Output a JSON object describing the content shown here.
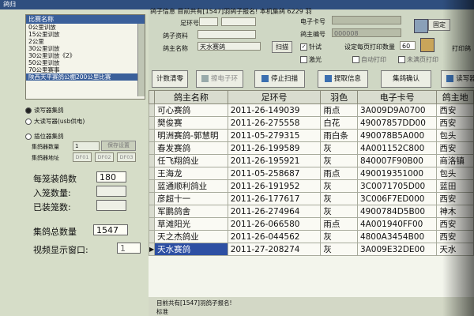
{
  "window": {
    "title": "鸽归"
  },
  "left": {
    "list_header": "比赛名称",
    "list_items": [
      "0公里训放",
      "15公里训放",
      "2公里",
      "30公里训放",
      "30公里训放《2》",
      "50公里训放",
      "70公里赛事",
      "陕西天平赛鸽公棚200公里比赛"
    ],
    "selected_index": 7,
    "radio1": "读写器集鸽",
    "radio2": "大读写器(usb供电)",
    "radio3": "插位器集鸽",
    "set_count_label": "集鸽器数量",
    "set_count_value": "1",
    "save_btn": "保存设置",
    "addr_label": "集鸽器地址",
    "addr1": "DF01",
    "addr2": "DF02",
    "addr3": "DF03",
    "per_cage_label": "每笼装鸽数",
    "per_cage_value": "180",
    "in_cage_label": "入笼数量:",
    "loaded_label": "已装笼数:",
    "total_label": "集鸽总数量",
    "total_value": "1547",
    "video_label": "视频显示窗口:",
    "video_value": "1"
  },
  "top": {
    "info": "鸽子信息  目前共有[1547]羽鸽子报名!  本机集鸽 6229 羽",
    "ring_label": "足环号",
    "pigeon_info_label": "鸽子资料",
    "owner_label": "鸽主名称",
    "owner_value": "天水赛鸽",
    "scan_btn": "扫描",
    "chip_label": "电子卡号",
    "loft_no_label": "鸽主编号",
    "loft_no_value": "000008",
    "check_label": "针试",
    "print_count_label": "设定每页打印数量",
    "print_count_value": "60",
    "laser_label": "激光",
    "auto_print_label": "自动打印",
    "unprinted_label": "未满页打印",
    "print_right": "打印鸽",
    "fixed_btn": "固定"
  },
  "toolbar": {
    "stats": "计数清零",
    "erase": "擦电子环",
    "stop": "停止扫描",
    "fetch": "提取信息",
    "confirm": "集鸽确认",
    "read": "读写器"
  },
  "table": {
    "columns": [
      "鸽主名称",
      "足环号",
      "羽色",
      "电子卡号",
      "鸽主地"
    ],
    "rows": [
      [
        "可心赛鸽",
        "2011-26-149039",
        "雨点",
        "3A009D9A0700",
        "西安"
      ],
      [
        "樊俊赛",
        "2011-26-275558",
        "白花",
        "49007857DD00",
        "西安"
      ],
      [
        "明洲赛鸽-郭慧明",
        "2011-05-279315",
        "雨白条",
        "490078B5A000",
        "包头"
      ],
      [
        "春发赛鸽",
        "2011-26-199589",
        "灰",
        "4A001152C800",
        "西安"
      ],
      [
        "任飞翔鸽业",
        "2011-26-195921",
        "灰",
        "840007F90B00",
        "商洛镇"
      ],
      [
        "王海龙",
        "2011-05-258687",
        "雨点",
        "490019351000",
        "包头"
      ],
      [
        "蓝通顺利鸽业",
        "2011-26-191952",
        "灰",
        "3C0071705D00",
        "蓝田"
      ],
      [
        "彦超十一",
        "2011-26-177617",
        "灰",
        "3C006F7ED000",
        "西安"
      ],
      [
        "军鹏鸽舍",
        "2011-26-274964",
        "灰",
        "4900784D5B00",
        "神木"
      ],
      [
        "草滩阳光",
        "2011-26-066580",
        "雨点",
        "4A001940FF00",
        "西安"
      ],
      [
        "天之杰鸽业",
        "2011-26-044562",
        "灰",
        "4800A3454B00",
        "西安"
      ],
      [
        "天水赛鸽",
        "2011-27-208274",
        "灰",
        "3A009E32DE00",
        "天水"
      ]
    ],
    "selected_row": 11
  },
  "status": {
    "line1": "目前共有[1547]羽鸽子报名!",
    "line2": "标准"
  }
}
